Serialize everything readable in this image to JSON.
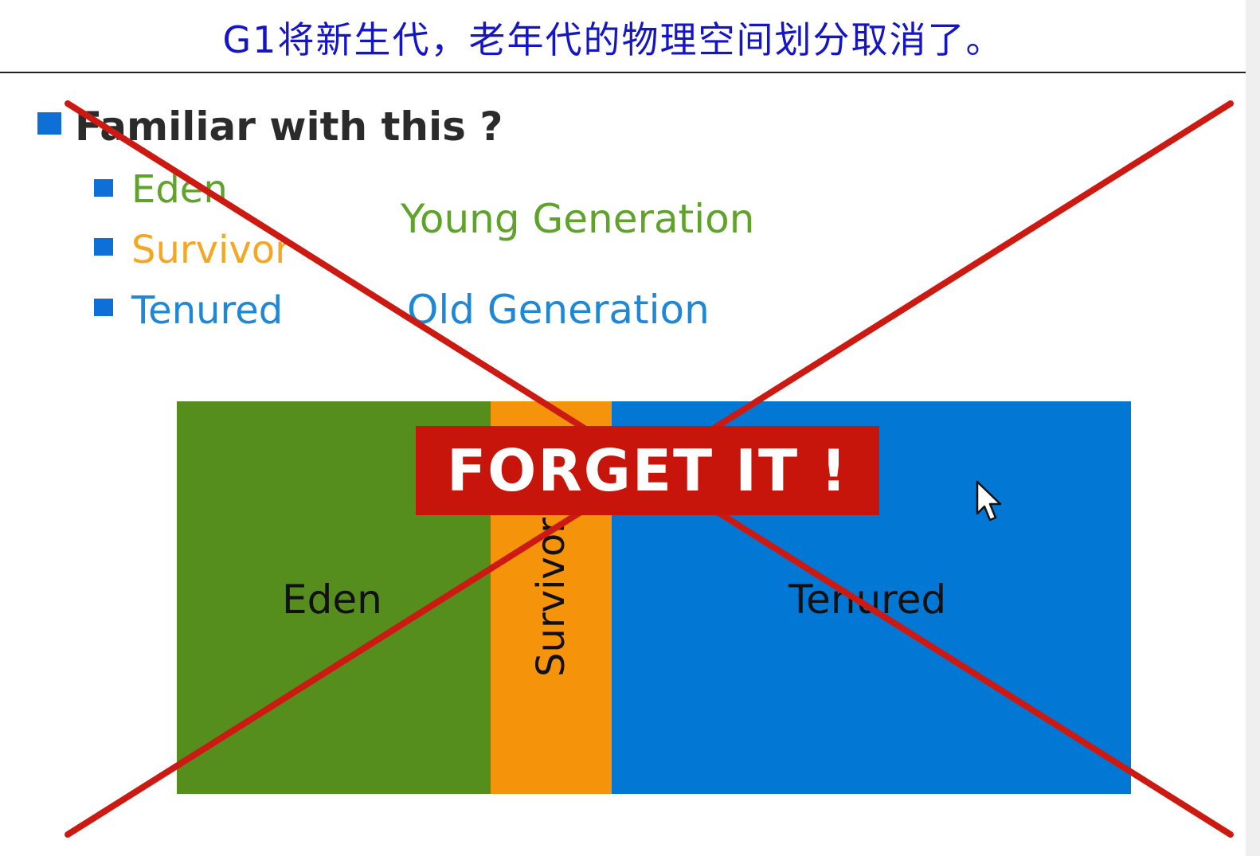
{
  "slide_title": "G1将新生代，老年代的物理空间划分取消了。",
  "heading": "Familiar with this ?",
  "items": [
    {
      "label": "Eden",
      "color": "#5fa32a"
    },
    {
      "label": "Survivor",
      "color": "#f5a623"
    },
    {
      "label": "Tenured",
      "color": "#1e88d6"
    }
  ],
  "generations": {
    "young": {
      "label": "Young Generation",
      "color": "#5fa32a"
    },
    "old": {
      "label": "Old Generation",
      "color": "#1e88d6"
    }
  },
  "diagram": {
    "eden": {
      "label": "Eden",
      "color": "#568e1e"
    },
    "survivor": {
      "label": "Survivor",
      "color": "#f5930b"
    },
    "tenured": {
      "label": "Tenured",
      "color": "#0278d4"
    }
  },
  "stamp": {
    "text": "FORGET IT !",
    "color": "#c8150c"
  },
  "cross_color": "#cc1a12",
  "bullet_color": "#0e6fd6",
  "cursor_icon": "mouse-pointer-icon"
}
